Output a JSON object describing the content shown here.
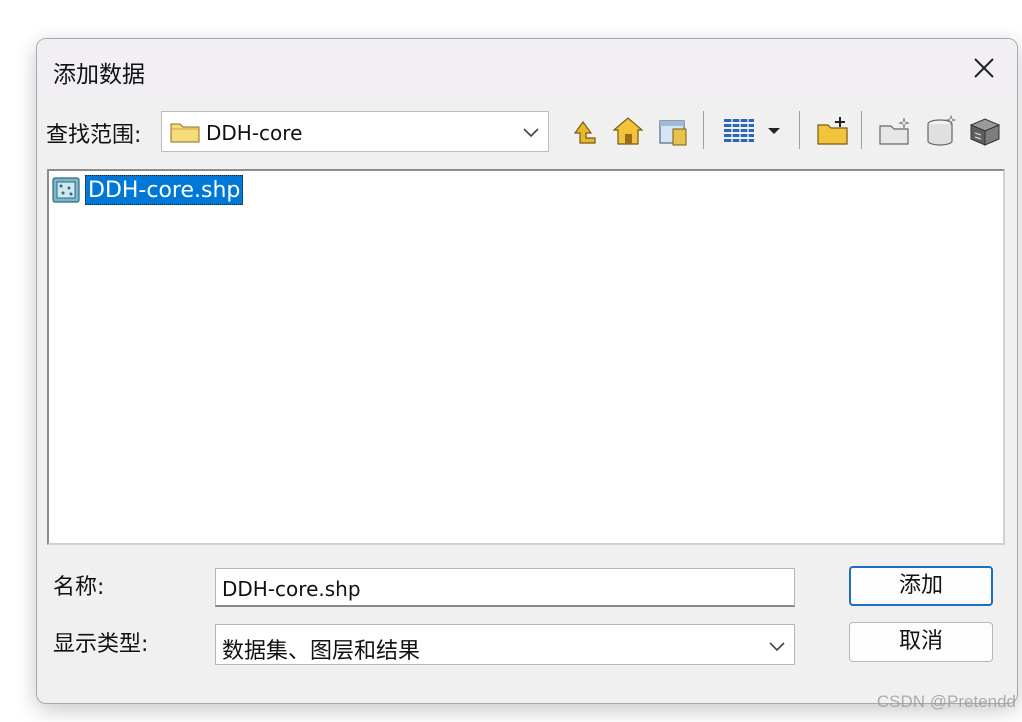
{
  "dialog": {
    "title": "添加数据",
    "close_icon": "close-icon"
  },
  "lookin": {
    "label": "查找范围:",
    "value": "DDH-core"
  },
  "toolbar": {
    "icons": [
      "up-one-level-icon",
      "home-icon",
      "connect-folder-icon",
      "list-view-icon",
      "view-dropdown-icon",
      "new-folder-icon",
      "new-item-icon",
      "database-icon",
      "toolbox-icon"
    ]
  },
  "files": [
    {
      "name": "DDH-core.shp",
      "icon": "shapefile-icon",
      "selected": true
    }
  ],
  "form": {
    "name_label": "名称:",
    "name_value": "DDH-core.shp",
    "type_label": "显示类型:",
    "type_value": "数据集、图层和结果"
  },
  "buttons": {
    "add": "添加",
    "cancel": "取消"
  },
  "watermark": "CSDN @Pretendd",
  "colors": {
    "selection": "#0078d7",
    "primary_border": "#1f6fbf",
    "dialog_bg": "#f0f0f0"
  }
}
